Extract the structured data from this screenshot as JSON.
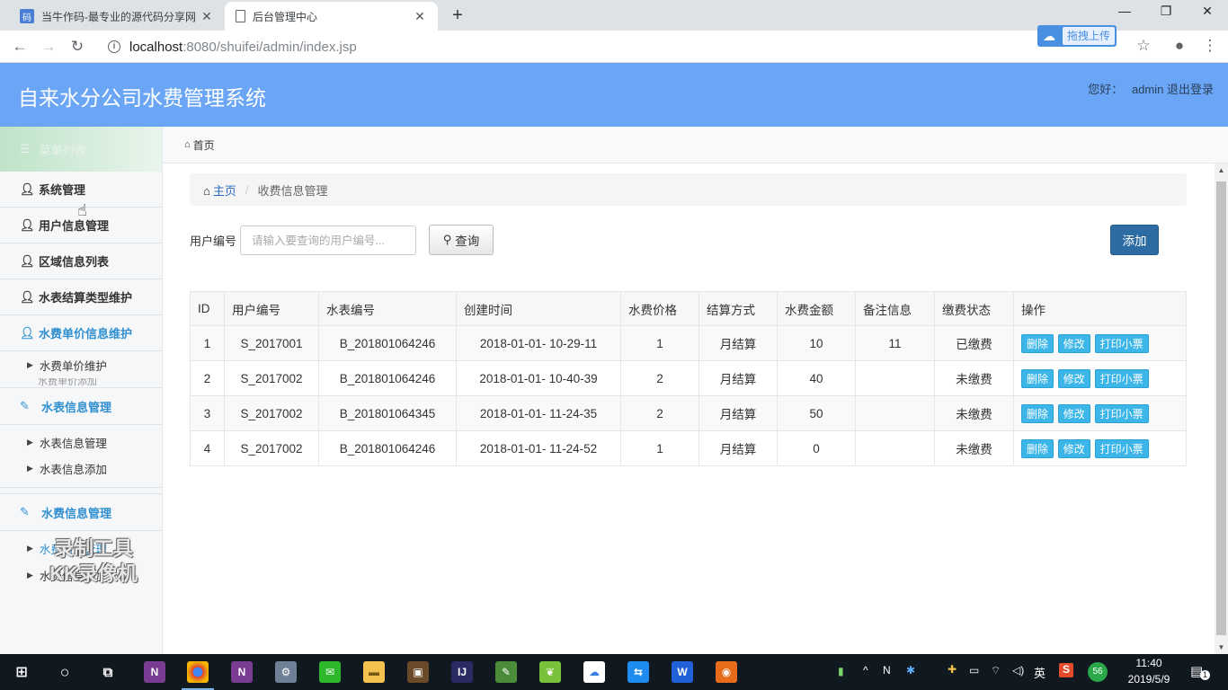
{
  "browser": {
    "tabs": [
      {
        "title": "当牛作码-最专业的源代码分享网",
        "active": false,
        "favicon": "码"
      },
      {
        "title": "后台管理中心",
        "active": true
      }
    ],
    "url_host": "localhost",
    "url_path": ":8080/shuifei/admin/index.jsp",
    "upload_label": "拖拽上传"
  },
  "header": {
    "title": "自来水分公司水费管理系统",
    "welcome": "您好：",
    "user": "admin",
    "logout": "退出登录"
  },
  "sidebar": {
    "heading": "菜单列表",
    "items": [
      {
        "label": "系统管理"
      },
      {
        "label": "用户信息管理"
      },
      {
        "label": "区域信息列表"
      },
      {
        "label": "水表结算类型维护"
      },
      {
        "label": "水费单价信息维护"
      }
    ],
    "price_sub": [
      "水费单价维护",
      "水费单价添加"
    ],
    "meter_group": "水表信息管理",
    "meter_sub": [
      "水表信息管理",
      "水表信息添加"
    ],
    "fee_group": "水费信息管理",
    "fee_sub": [
      "水费信息管理",
      "水费信息添加"
    ],
    "watermark": [
      "录制工具",
      "KK录像机"
    ]
  },
  "content": {
    "top_crumb": "首页",
    "crumb_home": "主页",
    "crumb_current": "收费信息管理",
    "search_label": "用户编号",
    "search_placeholder": "请输入要查询的用户编号...",
    "query_button": "查询",
    "add_button": "添加",
    "columns": [
      "ID",
      "用户编号",
      "水表编号",
      "创建时间",
      "水费价格",
      "结算方式",
      "水费金额",
      "备注信息",
      "缴费状态",
      "操作"
    ],
    "rows": [
      {
        "id": "1",
        "user": "S_2017001",
        "meter": "B_201801064246",
        "time": "2018-01-01- 10-29-11",
        "price": "1",
        "settle": "月结算",
        "amount": "10",
        "note": "11",
        "status": "已缴费"
      },
      {
        "id": "2",
        "user": "S_2017002",
        "meter": "B_201801064246",
        "time": "2018-01-01- 10-40-39",
        "price": "2",
        "settle": "月结算",
        "amount": "40",
        "note": "",
        "status": "未缴费"
      },
      {
        "id": "3",
        "user": "S_2017002",
        "meter": "B_201801064345",
        "time": "2018-01-01- 11-24-35",
        "price": "2",
        "settle": "月结算",
        "amount": "50",
        "note": "",
        "status": "未缴费"
      },
      {
        "id": "4",
        "user": "S_2017002",
        "meter": "B_201801064246",
        "time": "2018-01-01- 11-24-52",
        "price": "1",
        "settle": "月结算",
        "amount": "0",
        "note": "",
        "status": "未缴费"
      }
    ],
    "ops": {
      "delete": "删除",
      "edit": "修改",
      "print": "打印小票"
    }
  },
  "taskbar": {
    "time": "11:40",
    "date": "2019/5/9",
    "ime": "英",
    "badge": "56",
    "notifications": "1"
  },
  "colors": {
    "header_bg": "#6aa6f5",
    "accent": "#2f8fd0",
    "add_button": "#2d6ca2",
    "op_button": "#3cb5e8"
  }
}
